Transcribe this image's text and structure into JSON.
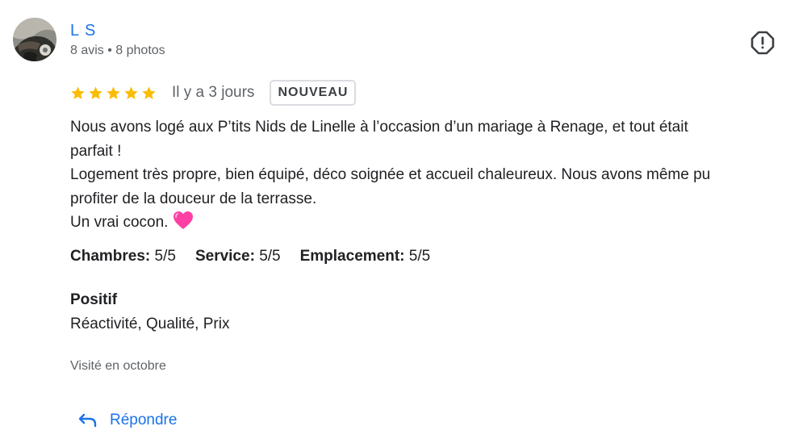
{
  "reviewer": {
    "name": "L S",
    "meta": "8 avis • 8 photos"
  },
  "review": {
    "stars": 5,
    "time": "Il y a 3 jours",
    "badge": "NOUVEAU",
    "lines": [
      "Nous avons logé aux P’tits Nids de Linelle à l’occasion d’un mariage à Renage, et tout était",
      "parfait !",
      "Logement très propre, bien équipé, déco soignée et accueil chaleureux. Nous avons même pu",
      "profiter de la douceur de la terrasse.",
      "Un vrai cocon."
    ],
    "emoji": "pink-heart"
  },
  "ratings": [
    {
      "label": "Chambres:",
      "value": "5/5"
    },
    {
      "label": "Service:",
      "value": "5/5"
    },
    {
      "label": "Emplacement:",
      "value": "5/5"
    }
  ],
  "positive": {
    "title": "Positif",
    "values": "Réactivité, Qualité, Prix"
  },
  "visited": "Visité en octobre",
  "actions": {
    "reply_label": "Répondre"
  },
  "icons": {
    "report": "report-icon",
    "reply": "reply-arrow-icon",
    "star": "star-icon"
  },
  "colors": {
    "link": "#1a73e8",
    "star": "#fbbc04",
    "muted": "#5f6368",
    "heart": "#ff3fa4"
  }
}
